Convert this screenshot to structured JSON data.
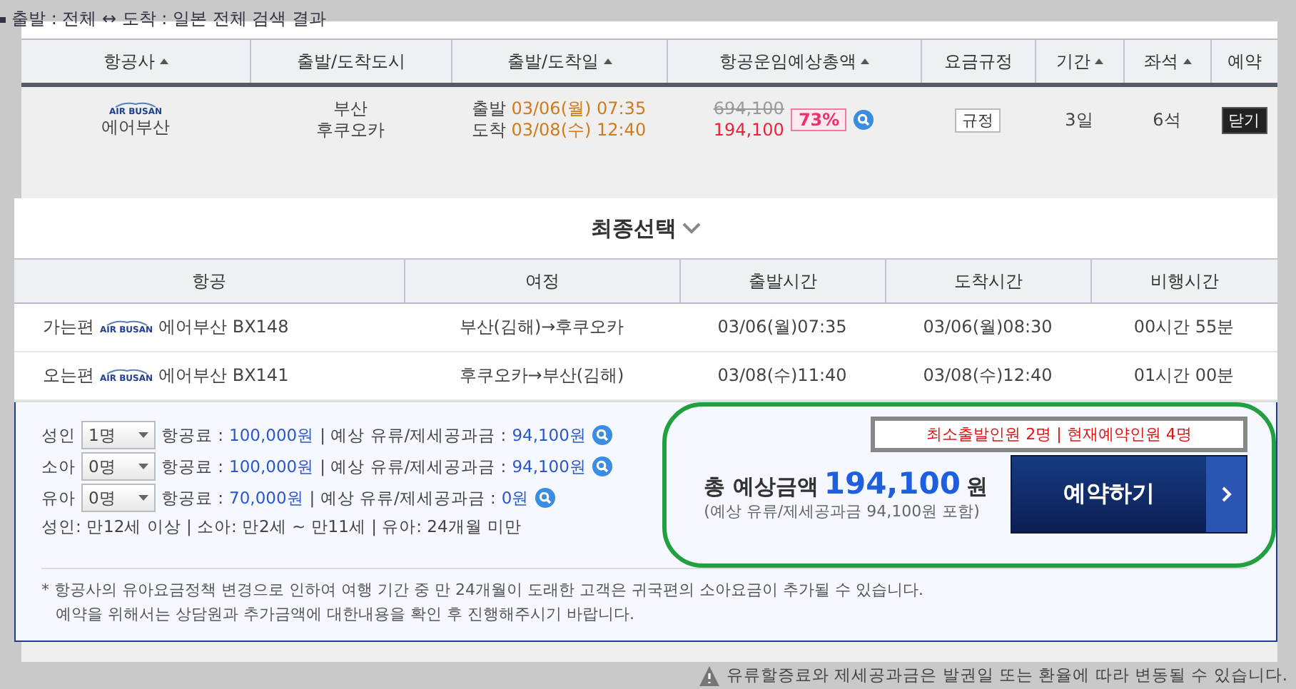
{
  "search_summary": "출발 : 전체 ↔ 도착 : 일본 전체 검색 결과",
  "results": {
    "columns": [
      {
        "label": "항공사",
        "sortable": true
      },
      {
        "label": "출발/도착도시",
        "sortable": false
      },
      {
        "label": "출발/도착일",
        "sortable": true
      },
      {
        "label": "항공운임예상총액",
        "sortable": true
      },
      {
        "label": "요금규정",
        "sortable": false
      },
      {
        "label": "기간",
        "sortable": true
      },
      {
        "label": "좌석",
        "sortable": true
      },
      {
        "label": "예약",
        "sortable": false
      }
    ],
    "rows": [
      {
        "logo": "AIR BUSAN",
        "airline": "에어부산",
        "cities": [
          "부산",
          "후쿠오카"
        ],
        "dates": [
          {
            "label": "출발",
            "value": "03/06(월) 07:35"
          },
          {
            "label": "도착",
            "value": "03/08(수) 12:40"
          }
        ],
        "original_price": "694,100",
        "price": "194,100",
        "discount": "73%",
        "rule": "규정",
        "duration": "3일",
        "seats": "6석",
        "action": "닫기"
      }
    ]
  },
  "final_selection": {
    "title": "최종선택",
    "columns": [
      "항공",
      "여정",
      "출발시간",
      "도착시간",
      "비행시간"
    ],
    "rows": [
      {
        "direction": "가는편",
        "logo": "AIR BUSAN",
        "flight": "에어부산 BX148",
        "route": "부산(김해)→후쿠오카",
        "departure": "03/06(월)07:35",
        "arrival": "03/06(월)08:30",
        "duration": "00시간 55분"
      },
      {
        "direction": "오는편",
        "logo": "AIR BUSAN",
        "flight": "에어부산 BX141",
        "route": "후쿠오카→부산(김해)",
        "departure": "03/08(수)11:40",
        "arrival": "03/08(수)12:40",
        "duration": "01시간 00분"
      }
    ]
  },
  "passengers": [
    {
      "label": "성인",
      "count": "1명",
      "fare_label": "항공료 :",
      "fare": "100,000원",
      "tax_label": "| 예상 유류/제세공과금 :",
      "tax": "94,100원"
    },
    {
      "label": "소아",
      "count": "0명",
      "fare_label": "항공료 :",
      "fare": "100,000원",
      "tax_label": "| 예상 유류/제세공과금 :",
      "tax": "94,100원"
    },
    {
      "label": "유아",
      "count": "0명",
      "fare_label": "항공료 :",
      "fare": "70,000원",
      "tax_label": "| 예상 유류/제세공과금 :",
      "tax": "0원"
    }
  ],
  "age_note": "성인: 만12세 이상 | 소아: 만2세 ~ 만11세 | 유아: 24개월 미만",
  "booking": {
    "min_notice": "최소출발인원 2명 | 현재예약인원 4명",
    "total_label": "총 예상금액",
    "total": "194,100",
    "currency": "원",
    "total_note": "(예상 유류/제세공과금 94,100원 포함)",
    "button": "예약하기"
  },
  "footnotes": [
    "* 항공사의 유아요금정책 변경으로 인하여 여행 기간 중 만 24개월이 도래한 고객은 귀국편의 소아요금이 추가될 수 있습니다.",
    "예약을 위해서는 상담원과 추가금액에 대한내용을 확인 후 진행해주시기 바랍니다."
  ],
  "bottom_notice": "유류할증료와 제세공과금은 발권일 또는 환율에 따라 변동될 수 있습니다."
}
